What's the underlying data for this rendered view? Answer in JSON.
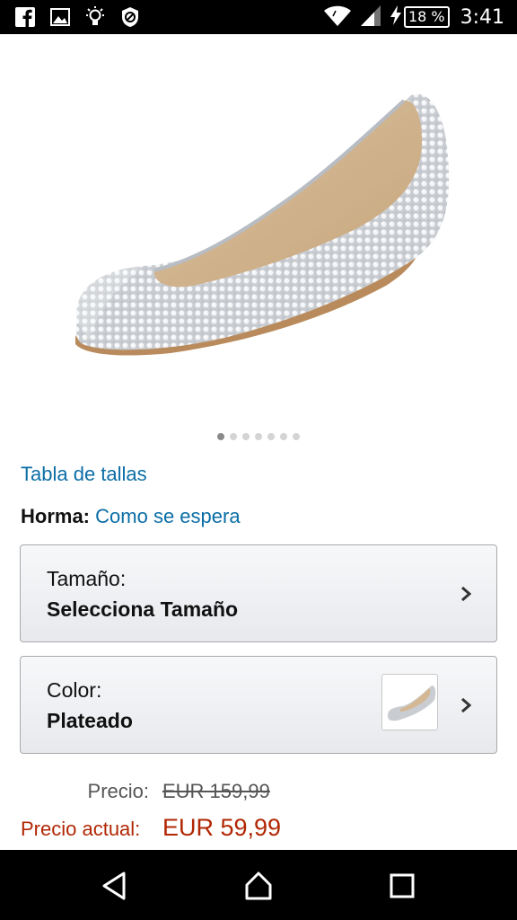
{
  "status_bar": {
    "icons": [
      "facebook-icon",
      "image-icon",
      "bulb-icon",
      "blocked-icon",
      "wifi-icon",
      "signal-icon",
      "charging-icon"
    ],
    "battery": "18 %",
    "time": "3:41"
  },
  "product": {
    "image": "silver-rhinestone-wedge-shoe",
    "carousel_count": 7,
    "carousel_active": 1
  },
  "size_chart_link": "Tabla de tallas",
  "fit": {
    "label": "Horma:",
    "value": "Como se espera"
  },
  "size_selector": {
    "label": "Tamaño:",
    "value": "Selecciona Tamaño"
  },
  "color_selector": {
    "label": "Color:",
    "value": "Plateado"
  },
  "price": {
    "list_label": "Precio:",
    "list_value": "EUR 159,99",
    "current_label": "Precio actual:",
    "current_value": "EUR 59,99"
  },
  "nav": {
    "back": "back-icon",
    "home": "home-icon",
    "recents": "recents-icon"
  },
  "colors": {
    "link": "#0b6ea6",
    "price": "#b12704"
  }
}
